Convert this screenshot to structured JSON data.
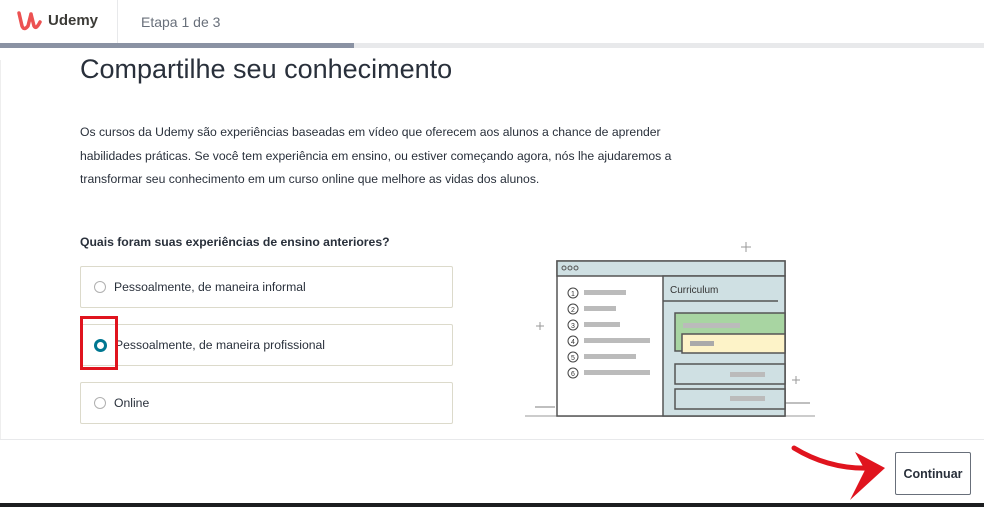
{
  "header": {
    "brand": "Udemy",
    "step": "Etapa 1 de 3",
    "progress_percent": 36
  },
  "main": {
    "title": "Compartilhe seu conhecimento",
    "description": "Os cursos da Udemy são experiências baseadas em vídeo que oferecem aos alunos a chance de aprender habilidades práticas. Se você tem experiência em ensino, ou estiver começando agora, nós lhe ajudaremos a transformar seu conhecimento em um curso online que melhore as vidas dos alunos.",
    "question": "Quais foram suas experiências de ensino anteriores?",
    "options": [
      {
        "label": "Pessoalmente, de maneira informal",
        "selected": false
      },
      {
        "label": "Pessoalmente, de maneira profissional",
        "selected": true
      },
      {
        "label": "Online",
        "selected": false
      }
    ],
    "illustration": {
      "panel_title": "Curriculum",
      "list_numbers": [
        "1",
        "2",
        "3",
        "4",
        "5",
        "6"
      ]
    }
  },
  "footer": {
    "continue_label": "Continuar"
  },
  "colors": {
    "accent": "#007791",
    "highlight": "#e0141e",
    "brand": "#ec5252"
  }
}
